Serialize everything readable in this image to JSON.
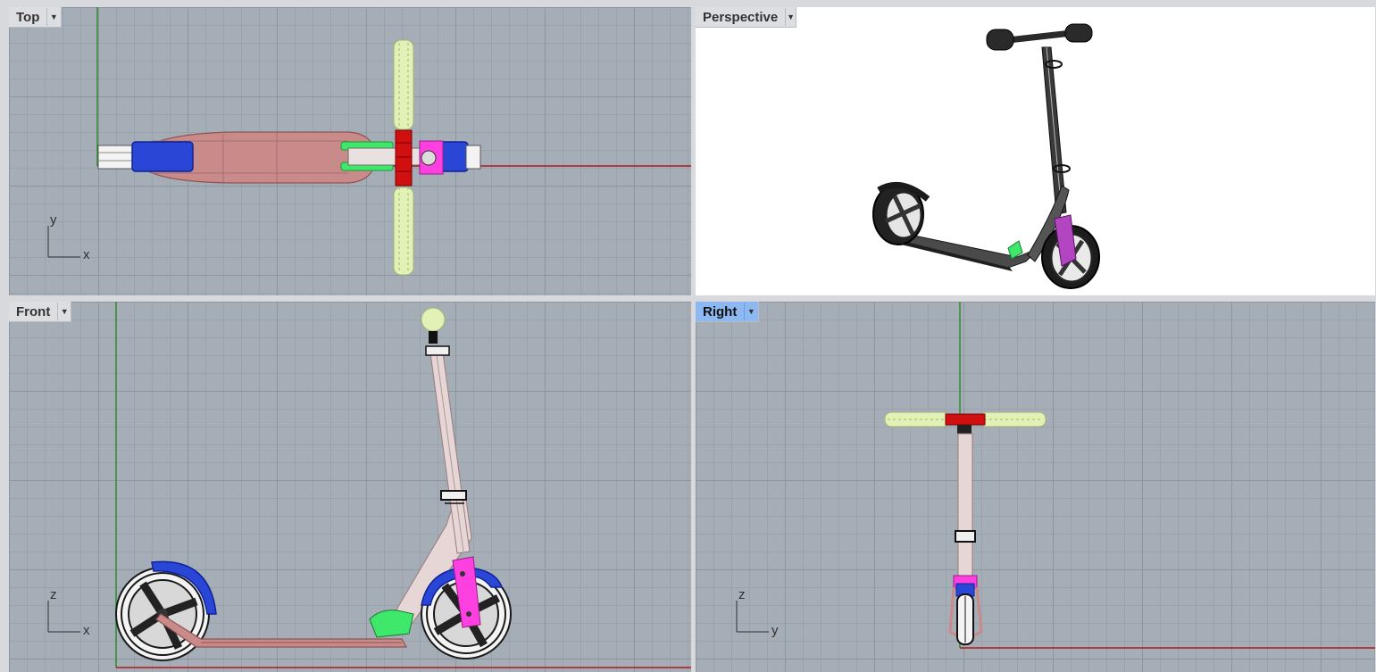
{
  "viewports": {
    "top": {
      "label": "Top",
      "axis_labels": {
        "vertical": "y",
        "horizontal": "x"
      }
    },
    "perspective": {
      "label": "Perspective"
    },
    "front": {
      "label": "Front",
      "axis_labels": {
        "vertical": "z",
        "horizontal": "x"
      }
    },
    "right": {
      "label": "Right",
      "axis_labels": {
        "vertical": "z",
        "horizontal": "y"
      },
      "active": true
    }
  },
  "icons": {
    "viewport_menu": "chevron-down-icon",
    "axis_gizmo": "axis-icon"
  },
  "colors": {
    "grid_background": "#a5adb6",
    "x_axis": "#b01818",
    "y_axis": "#2e8b2e",
    "deck": "#c98a8a",
    "wheel_cover": "#2a46d6",
    "headset": "#d01010",
    "fork_bracket": "#ff40e0",
    "handle_grip": "#e2f1b6",
    "brake_lever": "#3fe86a",
    "active_viewport": "#8eb8f2"
  }
}
